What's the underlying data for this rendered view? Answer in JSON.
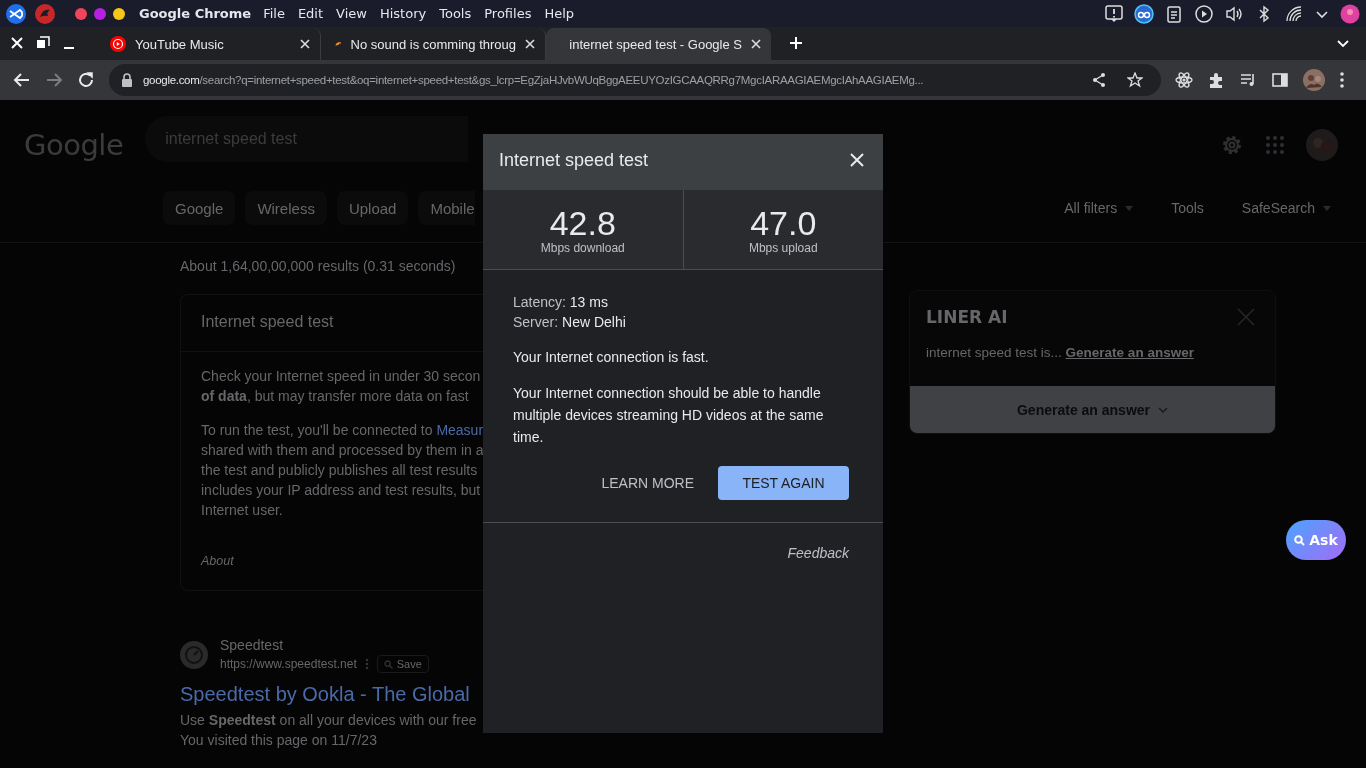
{
  "top_bar": {
    "app_name": "Google Chrome",
    "menus": [
      "File",
      "Edit",
      "View",
      "History",
      "Tools",
      "Profiles",
      "Help"
    ]
  },
  "tabs": [
    {
      "title": "YouTube Music",
      "kind": "music",
      "selected": false
    },
    {
      "title": "No sound is comming throug",
      "kind": "forum",
      "selected": false
    },
    {
      "title": "internet speed test - Google S",
      "kind": "google",
      "selected": true
    }
  ],
  "address_bar": {
    "domain": "google.com",
    "path": "/search?q=internet+speed+test&oq=internet+speed+test&gs_lcrp=EgZjaHJvbWUqBggAEEUYOzIGCAAQRRg7MgcIARAAGIAEMgcIAhAAGIAEMg..."
  },
  "page": {
    "logo": "Google",
    "search_query": "internet speed test",
    "chips": [
      "Google",
      "Wireless",
      "Upload",
      "Mobile"
    ],
    "filters": [
      {
        "label": "All filters",
        "dropdown": true
      },
      {
        "label": "Tools",
        "dropdown": false
      },
      {
        "label": "SafeSearch",
        "dropdown": true
      }
    ],
    "result_stats": "About 1,64,00,00,000 results (0.31 seconds)",
    "card": {
      "title": "Internet speed test",
      "paragraphs": [
        [
          {
            "text": "Check your Internet speed in under 30 secon"
          },
          {
            "text": "**of data**, but may transfer more data on fast"
          }
        ],
        [
          {
            "text": "To run the test, you'll be connected to ",
            "link": "Measur"
          },
          {
            "text": "shared with them and processed by them in a"
          },
          {
            "text": "the test and publicly publishes all test results"
          },
          {
            "text": "includes your IP address and test results, but"
          },
          {
            "text": "Internet user."
          }
        ]
      ],
      "about": "About"
    },
    "result": {
      "site": "Speedtest",
      "url": "https://www.speedtest.net",
      "save": "Save",
      "title": "Speedtest by Ookla - The Global",
      "snippet": "Use **Speedtest** on all your devices with our free",
      "visited": "You visited this page on 11/7/23"
    }
  },
  "liner": {
    "title": "LINER AI",
    "prompt": "internet speed test is...",
    "link": "Generate an answer",
    "button": "Generate an answer"
  },
  "ask_button": "Ask",
  "dialog": {
    "title": "Internet speed test",
    "stats": [
      {
        "value": "42.8",
        "label": "Mbps download"
      },
      {
        "value": "47.0",
        "label": "Mbps upload"
      }
    ],
    "details": [
      {
        "label": "Latency:",
        "value": "13 ms"
      },
      {
        "label": "Server:",
        "value": "New Delhi"
      }
    ],
    "verdict": "Your Internet connection is fast.",
    "description": "Your Internet connection should be able to handle multiple devices streaming HD videos at the same time.",
    "secondary_button": "LEARN MORE",
    "primary_button": "TEST AGAIN",
    "feedback": "Feedback"
  }
}
